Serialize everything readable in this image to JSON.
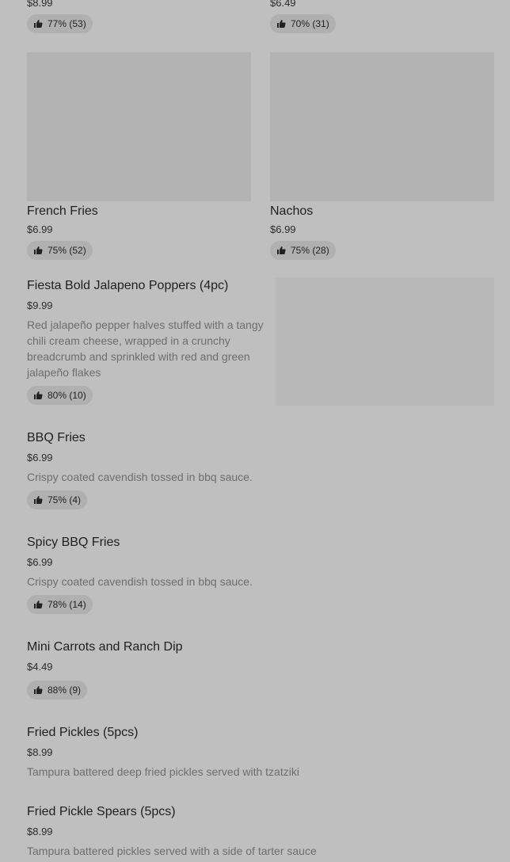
{
  "top_row": [
    {
      "price": "$8.99",
      "rating": "77% (53)"
    },
    {
      "price": "$6.49",
      "rating": "70% (31)"
    }
  ],
  "grid_items": [
    {
      "name": "French Fries",
      "price": "$6.99",
      "rating": "75% (52)"
    },
    {
      "name": "Nachos",
      "price": "$6.99",
      "rating": "75% (28)"
    }
  ],
  "list_items": [
    {
      "name": "Fiesta Bold Jalapeno Poppers (4pc)",
      "price": "$9.99",
      "description": "Red jalapeño pepper halves stuffed with a tangy chili cream cheese, wrapped in a crunchy breadcrumb and sprinkled with red and green jalapeño flakes",
      "rating": "80% (10)"
    },
    {
      "name": "BBQ Fries",
      "price": "$6.99",
      "description": "Crispy coated cavendish tossed in bbq sauce.",
      "rating": "75% (4)"
    },
    {
      "name": "Spicy BBQ Fries",
      "price": "$6.99",
      "description": "Crispy coated cavendish tossed in bbq sauce.",
      "rating": "78% (14)"
    },
    {
      "name": "Mini Carrots and Ranch Dip",
      "price": "$4.49",
      "rating": "88% (9)"
    },
    {
      "name": "Fried Pickles (5pcs)",
      "price": "$8.99",
      "description": "Tampura battered deep fried pickles served with tzatziki"
    },
    {
      "name": "Fried Pickle Spears (5pcs)",
      "price": "$8.99",
      "description": "Tampura battered pickles served with a side of tarter sauce"
    }
  ],
  "icons": {
    "rating": "thumbs-up-icon"
  }
}
